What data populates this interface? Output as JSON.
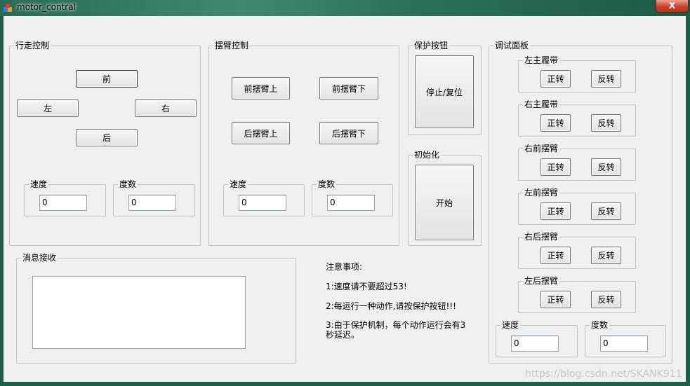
{
  "window": {
    "title": "motor_contral",
    "close_label": "X"
  },
  "walk": {
    "legend": "行走控制",
    "forward": "前",
    "left": "左",
    "right": "右",
    "back": "后",
    "speed_label": "速度",
    "speed_value": "0",
    "degree_label": "度数",
    "degree_value": "0"
  },
  "arm": {
    "legend": "摆臂控制",
    "front_up": "前摆臂上",
    "front_down": "前摆臂下",
    "rear_up": "后摆臂上",
    "rear_down": "后摆臂下",
    "speed_label": "速度",
    "speed_value": "0",
    "degree_label": "度数",
    "degree_value": "0"
  },
  "protect": {
    "legend": "保护按钮",
    "button": "停止/复位"
  },
  "init": {
    "legend": "初始化",
    "button": "开始"
  },
  "debug": {
    "legend": "调试面板",
    "rows": [
      {
        "label": "左主履带",
        "fwd": "正转",
        "rev": "反转"
      },
      {
        "label": "右主履带",
        "fwd": "正转",
        "rev": "反转"
      },
      {
        "label": "右前摆臂",
        "fwd": "正转",
        "rev": "反转"
      },
      {
        "label": "左前摆臂",
        "fwd": "正转",
        "rev": "反转"
      },
      {
        "label": "右后摆臂",
        "fwd": "正转",
        "rev": "反转"
      },
      {
        "label": "左后摆臂",
        "fwd": "正转",
        "rev": "反转"
      }
    ],
    "speed_label": "速度",
    "speed_value": "0",
    "degree_label": "度数",
    "degree_value": "0"
  },
  "messages": {
    "legend": "消息接收",
    "content": ""
  },
  "notes": {
    "title": "注意事项:",
    "line1": "1:速度请不要超过53!",
    "line2": "2:每运行一种动作,请按保护按钮!!!",
    "line3a": "3:由于保护机制，每个动作运行会有3",
    "line3b": "秒延迟。"
  },
  "watermark": "https://blog.csdn.net/SKANK911"
}
